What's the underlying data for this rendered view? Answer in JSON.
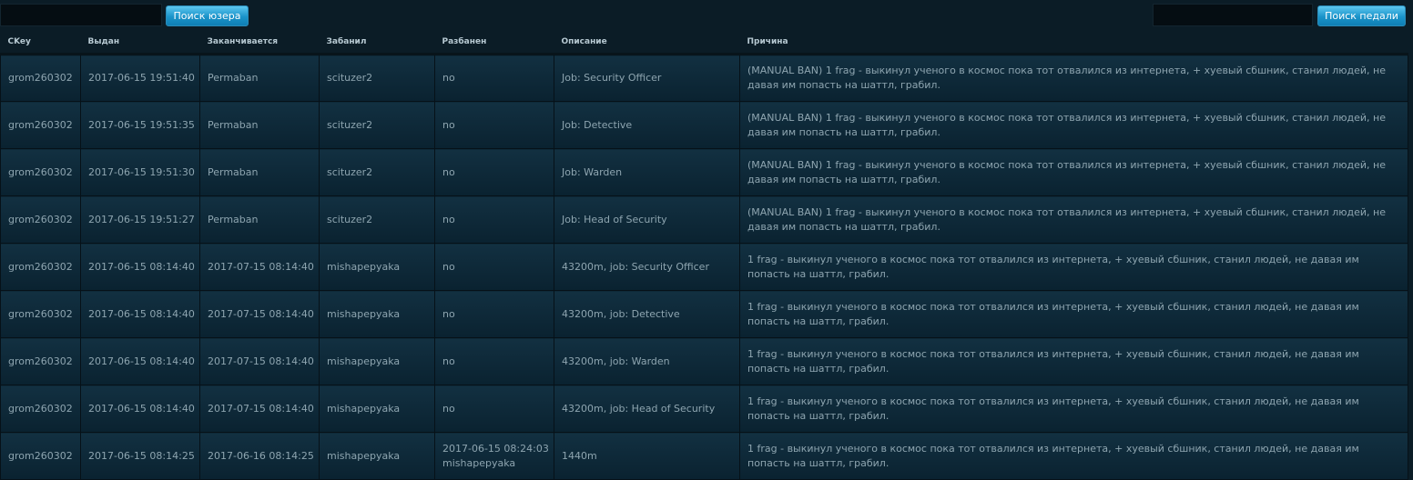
{
  "toolbar": {
    "user_search_value": "",
    "user_search_button": "Поиск юзера",
    "pedal_search_value": "",
    "pedal_search_button": "Поиск педали"
  },
  "columns": [
    "CKey",
    "Выдан",
    "Заканчивается",
    "Забанил",
    "Разбанен",
    "Описание",
    "Причина"
  ],
  "rows": [
    [
      "grom260302",
      "2017-06-15 19:51:40",
      "Permaban",
      "scituzer2",
      "no",
      "Job: Security Officer",
      "(MANUAL BAN) 1 frag - выкинул ученого в космос пока тот отвалился из интернета, + хуевый сбшник, станил людей, не давая им попасть на шаттл, грабил."
    ],
    [
      "grom260302",
      "2017-06-15 19:51:35",
      "Permaban",
      "scituzer2",
      "no",
      "Job: Detective",
      "(MANUAL BAN) 1 frag - выкинул ученого в космос пока тот отвалился из интернета, + хуевый сбшник, станил людей, не давая им попасть на шаттл, грабил."
    ],
    [
      "grom260302",
      "2017-06-15 19:51:30",
      "Permaban",
      "scituzer2",
      "no",
      "Job: Warden",
      "(MANUAL BAN) 1 frag - выкинул ученого в космос пока тот отвалился из интернета, + хуевый сбшник, станил людей, не давая им попасть на шаттл, грабил."
    ],
    [
      "grom260302",
      "2017-06-15 19:51:27",
      "Permaban",
      "scituzer2",
      "no",
      "Job: Head of Security",
      "(MANUAL BAN) 1 frag - выкинул ученого в космос пока тот отвалился из интернета, + хуевый сбшник, станил людей, не давая им попасть на шаттл, грабил."
    ],
    [
      "grom260302",
      "2017-06-15 08:14:40",
      "2017-07-15 08:14:40",
      "mishapepyaka",
      "no",
      "43200m, job: Security Officer",
      "1 frag - выкинул ученого в космос пока тот отвалился из интернета, + хуевый сбшник, станил людей, не давая им попасть на шаттл, грабил."
    ],
    [
      "grom260302",
      "2017-06-15 08:14:40",
      "2017-07-15 08:14:40",
      "mishapepyaka",
      "no",
      "43200m, job: Detective",
      "1 frag - выкинул ученого в космос пока тот отвалился из интернета, + хуевый сбшник, станил людей, не давая им попасть на шаттл, грабил."
    ],
    [
      "grom260302",
      "2017-06-15 08:14:40",
      "2017-07-15 08:14:40",
      "mishapepyaka",
      "no",
      "43200m, job: Warden",
      "1 frag - выкинул ученого в космос пока тот отвалился из интернета, + хуевый сбшник, станил людей, не давая им попасть на шаттл, грабил."
    ],
    [
      "grom260302",
      "2017-06-15 08:14:40",
      "2017-07-15 08:14:40",
      "mishapepyaka",
      "no",
      "43200m, job: Head of Security",
      "1 frag - выкинул ученого в космос пока тот отвалился из интернета, + хуевый сбшник, станил людей, не давая им попасть на шаттл, грабил."
    ],
    [
      "grom260302",
      "2017-06-15 08:14:25",
      "2017-06-16 08:14:25",
      "mishapepyaka",
      "2017-06-15 08:24:03 mishapepyaka",
      "1440m",
      "1 frag - выкинул ученого в космос пока тот отвалился из интернета, + хуевый сбшник, станил людей, не давая им попасть на шаттл, грабил."
    ]
  ]
}
